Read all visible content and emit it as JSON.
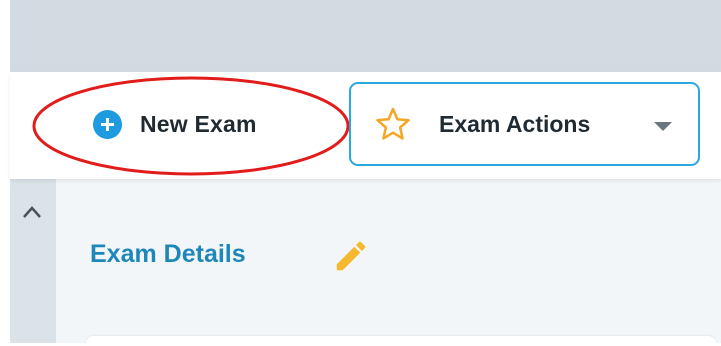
{
  "toolbar": {
    "new_exam_label": "New Exam",
    "exam_actions_label": "Exam Actions"
  },
  "section": {
    "title": "Exam Details"
  },
  "icons": {
    "new_exam": "plus-circle-icon",
    "exam_actions": "star-outline-icon",
    "dropdown": "caret-down-icon",
    "collapse": "chevron-up-icon",
    "edit": "pencil-icon"
  },
  "colors": {
    "accent_blue": "#1e9ae0",
    "title_blue": "#1f86b9",
    "star_orange": "#f5a623",
    "pencil_orange": "#f5b82e",
    "annotation_red": "#e21b1b",
    "button_border": "#2aa8e0"
  }
}
